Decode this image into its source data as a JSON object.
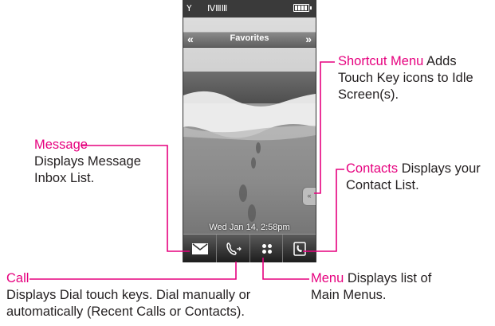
{
  "phone": {
    "status_icons": "Y",
    "status_indicator": "ⅣⅢⅢ",
    "title_bar": {
      "title": "Favorites",
      "left_arrow": "«",
      "right_arrow": "»"
    },
    "side_handle_glyph": "«",
    "datetime": "Wed Jan 14, 2:58pm",
    "touch_keys": [
      {
        "name": "message",
        "icon": "envelope-icon"
      },
      {
        "name": "call",
        "icon": "phone-dial-icon"
      },
      {
        "name": "menu",
        "icon": "four-dots-icon"
      },
      {
        "name": "contacts",
        "icon": "contact-book-icon"
      }
    ]
  },
  "callouts": {
    "shortcut": {
      "title": "Shortcut Menu",
      "desc_1": " Adds",
      "desc_2": "Touch Key icons to Idle",
      "desc_3": "Screen(s)."
    },
    "message": {
      "title": "Message",
      "desc_1": "Displays Message",
      "desc_2": "Inbox List."
    },
    "contacts": {
      "title": "Contacts",
      "desc_1": " Displays your",
      "desc_2": "Contact List."
    },
    "call": {
      "title": "Call",
      "desc_1": "Displays Dial touch keys. Dial manually or",
      "desc_2": "automatically (Recent Calls or Contacts)."
    },
    "menu": {
      "title": "Menu",
      "desc_1": " Displays list of",
      "desc_2": "Main Menus."
    }
  },
  "colors": {
    "highlight": "#e6007e",
    "text": "#231f20",
    "leader_line": "#e6007e"
  }
}
